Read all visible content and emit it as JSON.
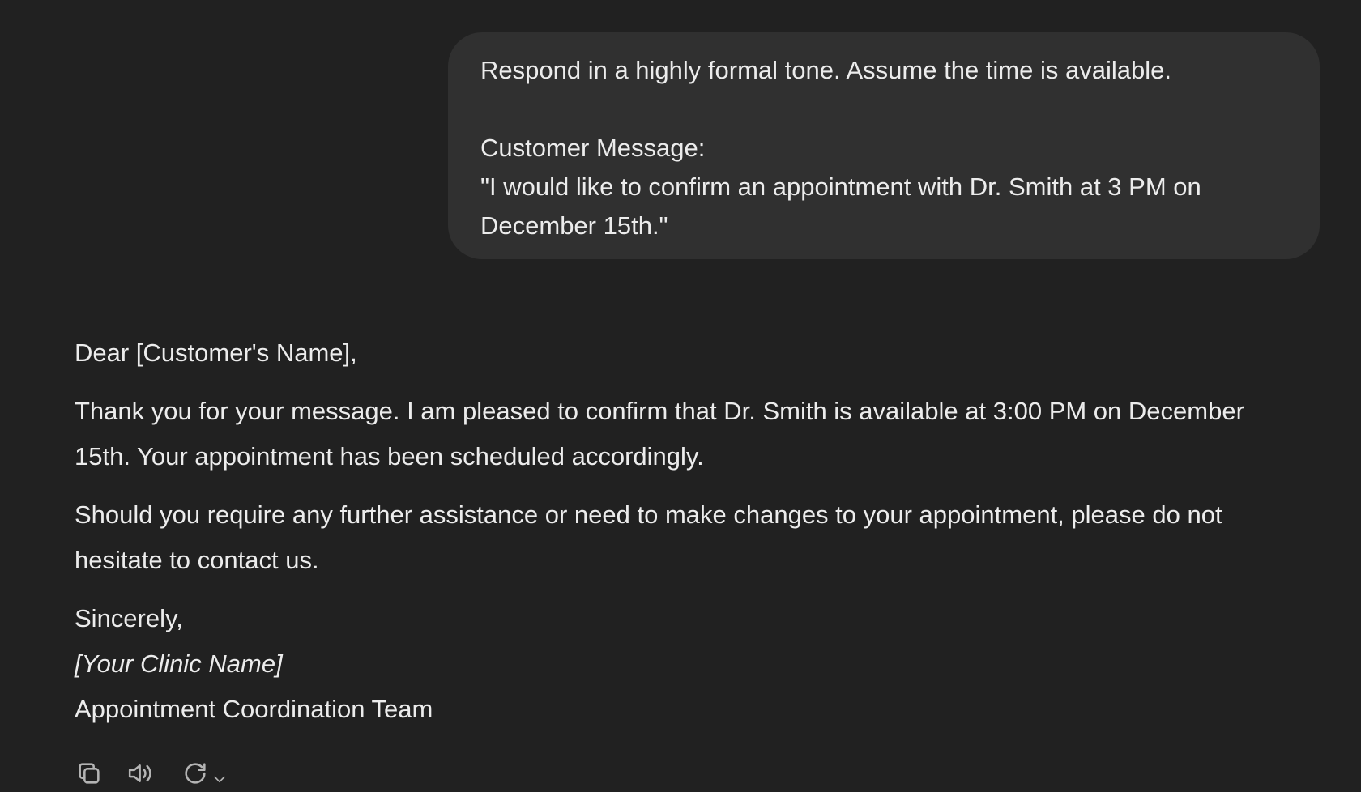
{
  "user_message": {
    "line1": "Respond in a highly formal tone. Assume the time is available.",
    "line2": "Customer Message:",
    "line3": "\"I would like to confirm an appointment with Dr. Smith at 3 PM on",
    "line4": "December 15th.\""
  },
  "assistant_message": {
    "salutation": "Dear [Customer's Name],",
    "paragraph1_line1": "Thank you for your message. I am pleased to confirm that Dr. Smith is available at 3:00 PM on December",
    "paragraph1_line2": "15th. Your appointment has been scheduled accordingly.",
    "paragraph2_line1": "Should you require any further assistance or need to make changes to your appointment, please do not",
    "paragraph2_line2": "hesitate to contact us.",
    "closing": "Sincerely,",
    "clinic_name": "[Your Clinic Name]",
    "team": "Appointment Coordination Team"
  },
  "actions": {
    "icons": [
      "copy-icon",
      "speaker-icon",
      "regenerate-icon",
      "chevron-down-icon"
    ]
  },
  "colors": {
    "background": "#212121",
    "bubble": "#303030",
    "text": "#ececec",
    "icon": "#b4b4b4"
  }
}
